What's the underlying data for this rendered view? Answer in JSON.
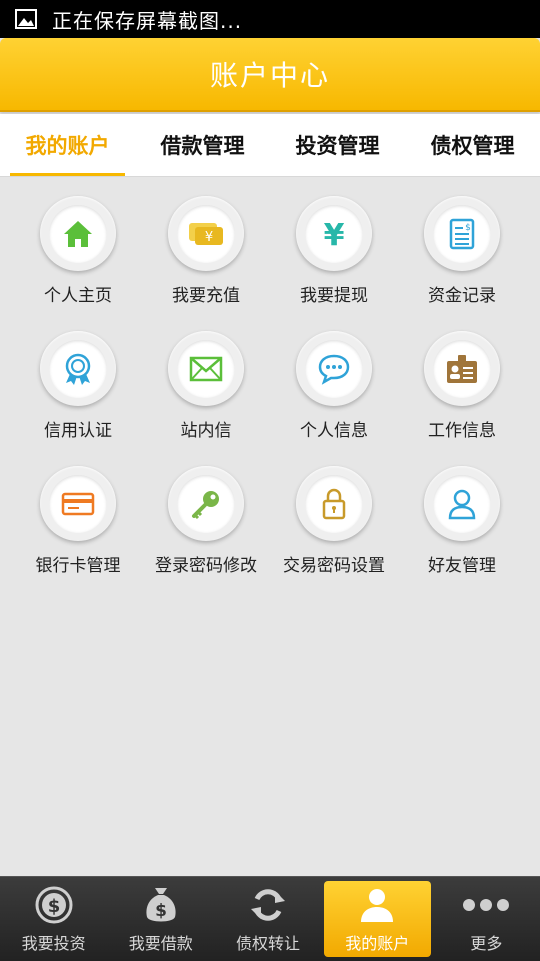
{
  "status_bar": {
    "text": "正在保存屏幕截图..."
  },
  "header": {
    "title": "账户中心"
  },
  "tabs": [
    {
      "label": "我的账户",
      "active": true
    },
    {
      "label": "借款管理",
      "active": false
    },
    {
      "label": "投资管理",
      "active": false
    },
    {
      "label": "债权管理",
      "active": false
    }
  ],
  "grid": [
    {
      "label": "个人主页",
      "icon": "home-icon"
    },
    {
      "label": "我要充值",
      "icon": "recharge-icon"
    },
    {
      "label": "我要提现",
      "icon": "yen-icon"
    },
    {
      "label": "资金记录",
      "icon": "fund-record-icon"
    },
    {
      "label": "信用认证",
      "icon": "credit-badge-icon"
    },
    {
      "label": "站内信",
      "icon": "mail-icon"
    },
    {
      "label": "个人信息",
      "icon": "chat-bubble-icon"
    },
    {
      "label": "工作信息",
      "icon": "id-card-icon"
    },
    {
      "label": "银行卡管理",
      "icon": "bank-card-icon"
    },
    {
      "label": "登录密码修改",
      "icon": "key-icon"
    },
    {
      "label": "交易密码设置",
      "icon": "lock-icon"
    },
    {
      "label": "好友管理",
      "icon": "user-icon"
    }
  ],
  "bottom_nav": [
    {
      "label": "我要投资",
      "icon": "dollar-coin-icon",
      "active": false
    },
    {
      "label": "我要借款",
      "icon": "money-bag-icon",
      "active": false
    },
    {
      "label": "债权转让",
      "icon": "refresh-icon",
      "active": false
    },
    {
      "label": "我的账户",
      "icon": "person-icon",
      "active": true
    },
    {
      "label": "更多",
      "icon": "more-dots-icon",
      "active": false
    }
  ],
  "colors": {
    "accent": "#f7b800",
    "active_tab": "#f2a900"
  }
}
